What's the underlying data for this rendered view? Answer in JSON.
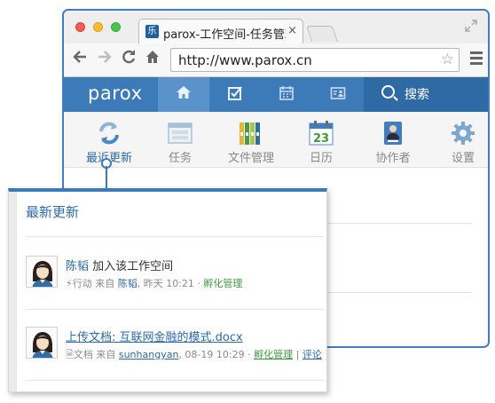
{
  "browser": {
    "tab_title": "parox-工作空间-任务管理",
    "tab_favicon": "乐",
    "tab_close": "×",
    "url": "http://www.parox.cn",
    "icons": [
      "back-arrow-icon",
      "forward-arrow-icon",
      "reload-icon",
      "home-icon",
      "star-icon",
      "menu-icon",
      "fullscreen-icon"
    ]
  },
  "app": {
    "brand": "parox",
    "nav_icons": [
      "home-icon",
      "checkbox-icon",
      "calendar-icon",
      "contact-card-icon"
    ],
    "search_label": "搜索"
  },
  "modules": [
    {
      "label": "最近更新",
      "icon": "refresh-arrows-icon"
    },
    {
      "label": "任务",
      "icon": "task-window-icon"
    },
    {
      "label": "文件管理",
      "icon": "binders-icon"
    },
    {
      "label": "日历",
      "icon": "calendar-icon",
      "day": "23"
    },
    {
      "label": "协作者",
      "icon": "collaborator-badge-icon"
    },
    {
      "label": "设置",
      "icon": "gear-icon"
    }
  ],
  "popover": {
    "title": "最新更新",
    "items": [
      {
        "user": "陈韬",
        "action": "加入该工作空间",
        "meta_type": "行动",
        "meta_from": "来自",
        "meta_user": "陈韬",
        "meta_time": ", 昨天 10:21 ·",
        "meta_space": "孵化管理",
        "meta_extra": ""
      },
      {
        "doc": "上传文档: 互联网金融的模式.docx",
        "meta_type": "文档",
        "meta_from": "来自",
        "meta_user": "sunhangyan",
        "meta_time": ", 08-19 10:29 ·",
        "meta_space": "孵化管理",
        "meta_sep": "|",
        "meta_extra": "评论"
      }
    ]
  },
  "colors": {
    "accent": "#3d7ab8",
    "link": "#2c6aa8",
    "green": "#3f9a3f"
  }
}
